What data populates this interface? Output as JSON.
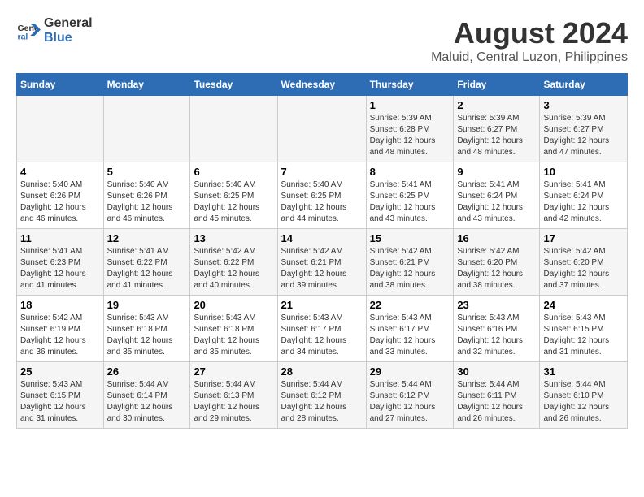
{
  "logo": {
    "line1": "General",
    "line2": "Blue"
  },
  "title": "August 2024",
  "subtitle": "Maluid, Central Luzon, Philippines",
  "weekdays": [
    "Sunday",
    "Monday",
    "Tuesday",
    "Wednesday",
    "Thursday",
    "Friday",
    "Saturday"
  ],
  "weeks": [
    [
      {
        "day": "",
        "info": ""
      },
      {
        "day": "",
        "info": ""
      },
      {
        "day": "",
        "info": ""
      },
      {
        "day": "",
        "info": ""
      },
      {
        "day": "1",
        "info": "Sunrise: 5:39 AM\nSunset: 6:28 PM\nDaylight: 12 hours and 48 minutes."
      },
      {
        "day": "2",
        "info": "Sunrise: 5:39 AM\nSunset: 6:27 PM\nDaylight: 12 hours and 48 minutes."
      },
      {
        "day": "3",
        "info": "Sunrise: 5:39 AM\nSunset: 6:27 PM\nDaylight: 12 hours and 47 minutes."
      }
    ],
    [
      {
        "day": "4",
        "info": "Sunrise: 5:40 AM\nSunset: 6:26 PM\nDaylight: 12 hours and 46 minutes."
      },
      {
        "day": "5",
        "info": "Sunrise: 5:40 AM\nSunset: 6:26 PM\nDaylight: 12 hours and 46 minutes."
      },
      {
        "day": "6",
        "info": "Sunrise: 5:40 AM\nSunset: 6:25 PM\nDaylight: 12 hours and 45 minutes."
      },
      {
        "day": "7",
        "info": "Sunrise: 5:40 AM\nSunset: 6:25 PM\nDaylight: 12 hours and 44 minutes."
      },
      {
        "day": "8",
        "info": "Sunrise: 5:41 AM\nSunset: 6:25 PM\nDaylight: 12 hours and 43 minutes."
      },
      {
        "day": "9",
        "info": "Sunrise: 5:41 AM\nSunset: 6:24 PM\nDaylight: 12 hours and 43 minutes."
      },
      {
        "day": "10",
        "info": "Sunrise: 5:41 AM\nSunset: 6:24 PM\nDaylight: 12 hours and 42 minutes."
      }
    ],
    [
      {
        "day": "11",
        "info": "Sunrise: 5:41 AM\nSunset: 6:23 PM\nDaylight: 12 hours and 41 minutes."
      },
      {
        "day": "12",
        "info": "Sunrise: 5:41 AM\nSunset: 6:22 PM\nDaylight: 12 hours and 41 minutes."
      },
      {
        "day": "13",
        "info": "Sunrise: 5:42 AM\nSunset: 6:22 PM\nDaylight: 12 hours and 40 minutes."
      },
      {
        "day": "14",
        "info": "Sunrise: 5:42 AM\nSunset: 6:21 PM\nDaylight: 12 hours and 39 minutes."
      },
      {
        "day": "15",
        "info": "Sunrise: 5:42 AM\nSunset: 6:21 PM\nDaylight: 12 hours and 38 minutes."
      },
      {
        "day": "16",
        "info": "Sunrise: 5:42 AM\nSunset: 6:20 PM\nDaylight: 12 hours and 38 minutes."
      },
      {
        "day": "17",
        "info": "Sunrise: 5:42 AM\nSunset: 6:20 PM\nDaylight: 12 hours and 37 minutes."
      }
    ],
    [
      {
        "day": "18",
        "info": "Sunrise: 5:42 AM\nSunset: 6:19 PM\nDaylight: 12 hours and 36 minutes."
      },
      {
        "day": "19",
        "info": "Sunrise: 5:43 AM\nSunset: 6:18 PM\nDaylight: 12 hours and 35 minutes."
      },
      {
        "day": "20",
        "info": "Sunrise: 5:43 AM\nSunset: 6:18 PM\nDaylight: 12 hours and 35 minutes."
      },
      {
        "day": "21",
        "info": "Sunrise: 5:43 AM\nSunset: 6:17 PM\nDaylight: 12 hours and 34 minutes."
      },
      {
        "day": "22",
        "info": "Sunrise: 5:43 AM\nSunset: 6:17 PM\nDaylight: 12 hours and 33 minutes."
      },
      {
        "day": "23",
        "info": "Sunrise: 5:43 AM\nSunset: 6:16 PM\nDaylight: 12 hours and 32 minutes."
      },
      {
        "day": "24",
        "info": "Sunrise: 5:43 AM\nSunset: 6:15 PM\nDaylight: 12 hours and 31 minutes."
      }
    ],
    [
      {
        "day": "25",
        "info": "Sunrise: 5:43 AM\nSunset: 6:15 PM\nDaylight: 12 hours and 31 minutes."
      },
      {
        "day": "26",
        "info": "Sunrise: 5:44 AM\nSunset: 6:14 PM\nDaylight: 12 hours and 30 minutes."
      },
      {
        "day": "27",
        "info": "Sunrise: 5:44 AM\nSunset: 6:13 PM\nDaylight: 12 hours and 29 minutes."
      },
      {
        "day": "28",
        "info": "Sunrise: 5:44 AM\nSunset: 6:12 PM\nDaylight: 12 hours and 28 minutes."
      },
      {
        "day": "29",
        "info": "Sunrise: 5:44 AM\nSunset: 6:12 PM\nDaylight: 12 hours and 27 minutes."
      },
      {
        "day": "30",
        "info": "Sunrise: 5:44 AM\nSunset: 6:11 PM\nDaylight: 12 hours and 26 minutes."
      },
      {
        "day": "31",
        "info": "Sunrise: 5:44 AM\nSunset: 6:10 PM\nDaylight: 12 hours and 26 minutes."
      }
    ]
  ]
}
